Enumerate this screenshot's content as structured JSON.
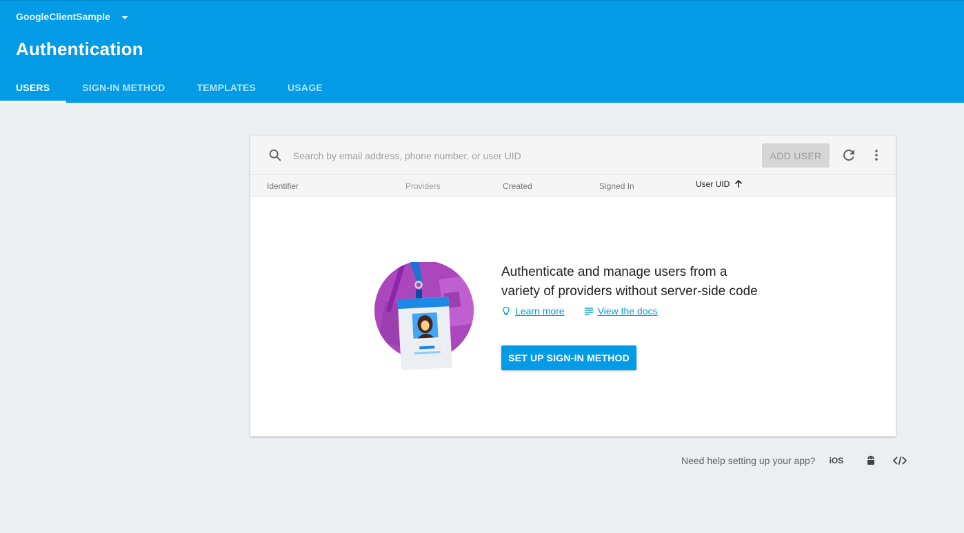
{
  "header": {
    "project_name": "GoogleClientSample",
    "page_title": "Authentication",
    "tabs": [
      {
        "label": "USERS",
        "active": true
      },
      {
        "label": "SIGN-IN METHOD",
        "active": false
      },
      {
        "label": "TEMPLATES",
        "active": false
      },
      {
        "label": "USAGE",
        "active": false
      }
    ]
  },
  "users_card": {
    "search_placeholder": "Search by email address, phone number, or user UID",
    "add_user_label": "ADD USER",
    "columns": [
      "Identifier",
      "Providers",
      "Created",
      "Signed In",
      "User UID"
    ],
    "sorted_column": "User UID",
    "empty_state": {
      "headline_line1": "Authenticate and manage users from a",
      "headline_line2": "variety of providers without server-side code",
      "learn_more": "Learn more",
      "view_docs": "View the docs",
      "setup_button": "SET UP SIGN-IN METHOD"
    }
  },
  "help": {
    "text": "Need help setting up your app?",
    "ios_label": "iOS",
    "icons": [
      "android-icon",
      "web-code-icon"
    ]
  },
  "colors": {
    "header_bg": "#039be5",
    "page_bg": "#eceff1",
    "accent": "#039be5",
    "illustration_purple": "#ab47bc"
  }
}
